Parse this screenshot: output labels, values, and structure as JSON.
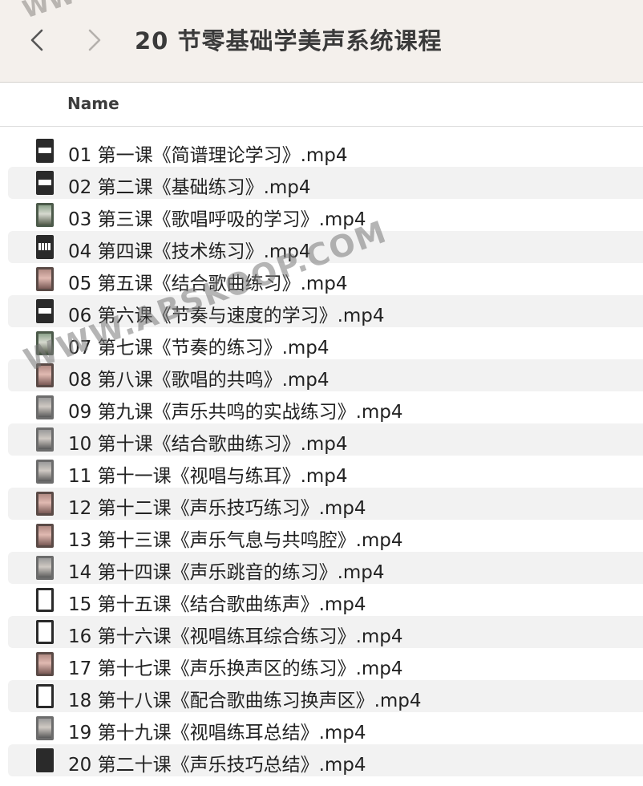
{
  "window": {
    "title": "20 节零基础学美声系统课程",
    "back_icon": "chevron-left-icon",
    "forward_icon": "chevron-right-icon"
  },
  "header": {
    "name_column": "Name"
  },
  "files": [
    {
      "name": "01 第一课《简谱理论学习》.mp4",
      "thumb": "black"
    },
    {
      "name": "02 第二课《基础练习》.mp4",
      "thumb": "black"
    },
    {
      "name": "03 第三课《歌唱呼吸的学习》.mp4",
      "thumb": "portrait-green"
    },
    {
      "name": "04 第四课《技术练习》.mp4",
      "thumb": "piano"
    },
    {
      "name": "05 第五课《结合歌曲练习》.mp4",
      "thumb": "portrait-warm"
    },
    {
      "name": "06 第六课《节奏与速度的学习》.mp4",
      "thumb": "black"
    },
    {
      "name": "07 第七课《节奏的练习》.mp4",
      "thumb": "portrait-green"
    },
    {
      "name": "08 第八课《歌唱的共鸣》.mp4",
      "thumb": "portrait-warm"
    },
    {
      "name": "09 第九课《声乐共鸣的实战练习》.mp4",
      "thumb": "portrait"
    },
    {
      "name": "10 第十课《结合歌曲练习》.mp4",
      "thumb": "portrait"
    },
    {
      "name": "11 第十一课《视唱与练耳》.mp4",
      "thumb": "portrait"
    },
    {
      "name": "12 第十二课《声乐技巧练习》.mp4",
      "thumb": "portrait-warm"
    },
    {
      "name": "13 第十三课《声乐气息与共鸣腔》.mp4",
      "thumb": "portrait-warm"
    },
    {
      "name": "14 第十四课《声乐跳音的练习》.mp4",
      "thumb": "portrait"
    },
    {
      "name": "15 第十五课《结合歌曲练声》.mp4",
      "thumb": "white"
    },
    {
      "name": "16 第十六课《视唱练耳综合练习》.mp4",
      "thumb": "white"
    },
    {
      "name": "17 第十七课《声乐换声区的练习》.mp4",
      "thumb": "portrait-warm"
    },
    {
      "name": "18 第十八课《配合歌曲练习换声区》.mp4",
      "thumb": "white"
    },
    {
      "name": "19 第十九课《视唱练耳总结》.mp4",
      "thumb": "portrait"
    },
    {
      "name": "20 第二十课《声乐技巧总结》.mp4",
      "thumb": "solid"
    }
  ],
  "watermark": {
    "main": "WWW.ABSKOOP.COM",
    "top": "WW"
  }
}
